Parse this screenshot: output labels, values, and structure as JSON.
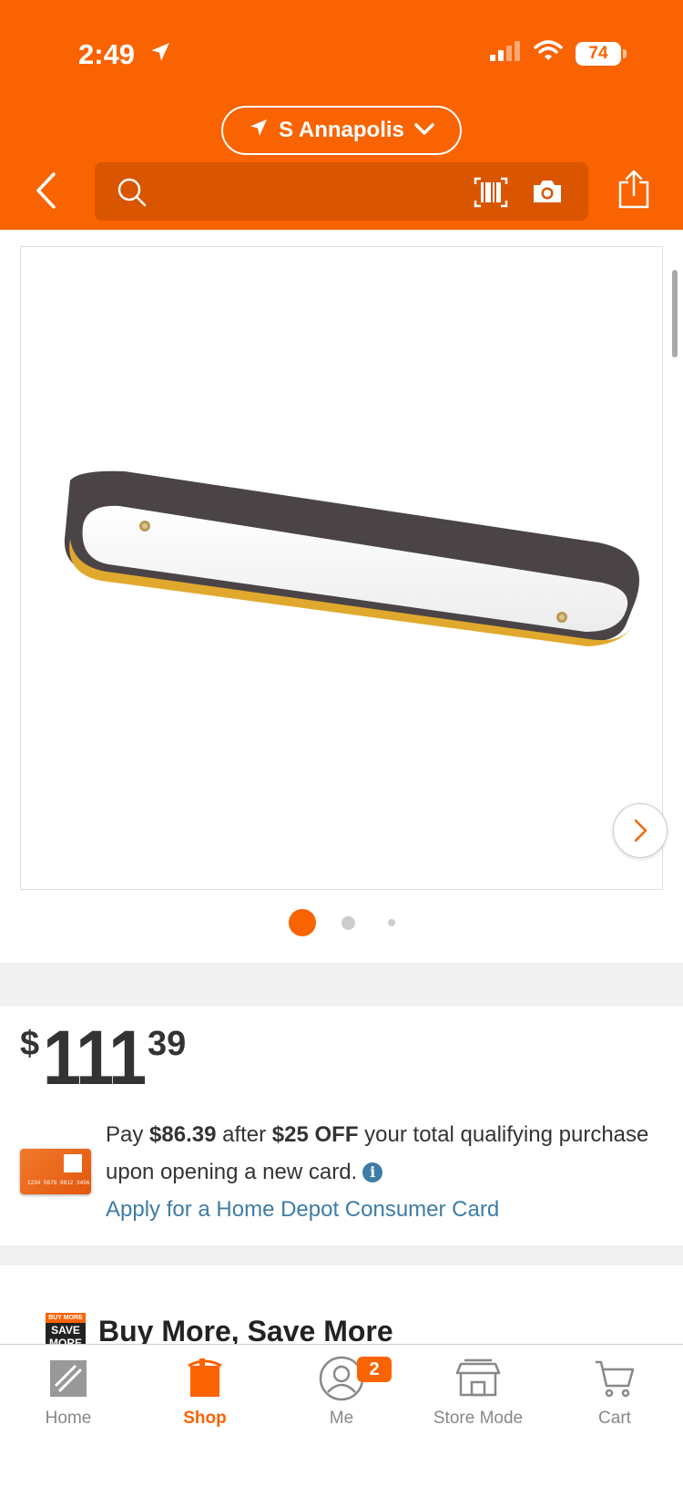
{
  "status_bar": {
    "time": "2:49",
    "battery": "74"
  },
  "header": {
    "store_name": "S Annapolis",
    "search_placeholder": ""
  },
  "gallery": {
    "slide_count": 3,
    "active_slide": 1
  },
  "price": {
    "dollar_sign": "$",
    "whole": "111",
    "cents": "39"
  },
  "card_offer": {
    "line_pay": "Pay ",
    "after_price": "$86.39",
    "after_word": " after ",
    "discount": "$25 OFF",
    "rest": " your total qualifying purchase upon opening a new card.",
    "info_glyph": "i",
    "apply_link": "Apply for a Home Depot Consumer Card",
    "card_number": "1234 5678 9012 3456"
  },
  "promo": {
    "badge_top": "BUY MORE",
    "badge_main": "SAVE MORE",
    "title": "Buy More, Save More"
  },
  "tabs": [
    {
      "label": "Home",
      "icon": "home-depot-logo-icon"
    },
    {
      "label": "Shop",
      "icon": "paint-bucket-icon"
    },
    {
      "label": "Me",
      "icon": "user-icon",
      "badge": "2"
    },
    {
      "label": "Store Mode",
      "icon": "store-icon"
    },
    {
      "label": "Cart",
      "icon": "cart-icon"
    }
  ],
  "colors": {
    "brand_orange": "#f96302",
    "search_bg": "#d95500",
    "link_blue": "#3e7ca6",
    "text_dark": "#333333"
  }
}
